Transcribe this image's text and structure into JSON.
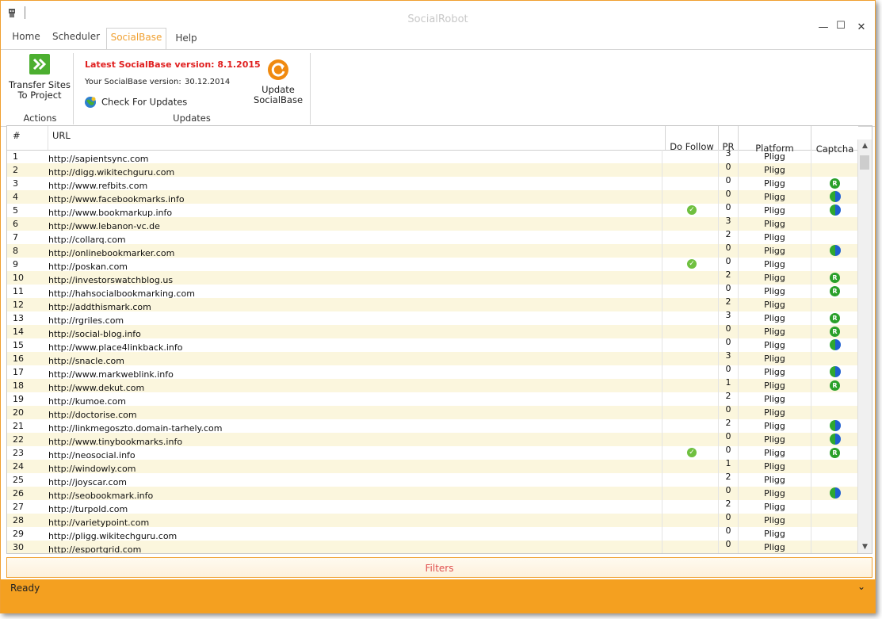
{
  "window": {
    "title": "SocialRobot",
    "minimize": "—",
    "maximize": "☐",
    "close": "✕"
  },
  "tabs": [
    "Home",
    "Scheduler",
    "SocialBase",
    "Help"
  ],
  "ribbon": {
    "actions": {
      "transfer_label_1": "Transfer Sites",
      "transfer_label_2": "To Project",
      "group_label": "Actions"
    },
    "updates": {
      "latest": "Latest SocialBase version: 8.1.2015",
      "yours_label": "Your SocialBase version:",
      "yours_value": "30.12.2014",
      "check": "Check For Updates",
      "update_label_1": "Update",
      "update_label_2": "SocialBase",
      "group_label": "Updates"
    }
  },
  "grid": {
    "headers": {
      "num": "#",
      "url": "URL",
      "dofollow": "Do Follow",
      "pr": "PR",
      "platform": "Platform",
      "captcha": "Captcha"
    },
    "rows": [
      {
        "n": "1",
        "url": "http://sapientsync.com",
        "df": false,
        "pr": "3",
        "plat": "Pligg",
        "cap": ""
      },
      {
        "n": "2",
        "url": "http://digg.wikitechguru.com",
        "df": false,
        "pr": "0",
        "plat": "Pligg",
        "cap": ""
      },
      {
        "n": "3",
        "url": "http://www.refbits.com",
        "df": false,
        "pr": "0",
        "plat": "Pligg",
        "cap": "R"
      },
      {
        "n": "4",
        "url": "http://www.facebookmarks.info",
        "df": false,
        "pr": "0",
        "plat": "Pligg",
        "cap": "B"
      },
      {
        "n": "5",
        "url": "http://www.bookmarkup.info",
        "df": true,
        "pr": "0",
        "plat": "Pligg",
        "cap": "B"
      },
      {
        "n": "6",
        "url": "http://www.lebanon-vc.de",
        "df": false,
        "pr": "3",
        "plat": "Pligg",
        "cap": ""
      },
      {
        "n": "7",
        "url": "http://collarq.com",
        "df": false,
        "pr": "2",
        "plat": "Pligg",
        "cap": ""
      },
      {
        "n": "8",
        "url": "http://onlinebookmarker.com",
        "df": false,
        "pr": "0",
        "plat": "Pligg",
        "cap": "B"
      },
      {
        "n": "9",
        "url": "http://poskan.com",
        "df": true,
        "pr": "0",
        "plat": "Pligg",
        "cap": ""
      },
      {
        "n": "10",
        "url": "http://investorswatchblog.us",
        "df": false,
        "pr": "2",
        "plat": "Pligg",
        "cap": "R"
      },
      {
        "n": "11",
        "url": "http://hahsocialbookmarking.com",
        "df": false,
        "pr": "0",
        "plat": "Pligg",
        "cap": "R"
      },
      {
        "n": "12",
        "url": "http://addthismark.com",
        "df": false,
        "pr": "2",
        "plat": "Pligg",
        "cap": ""
      },
      {
        "n": "13",
        "url": "http://rgriles.com",
        "df": false,
        "pr": "3",
        "plat": "Pligg",
        "cap": "R"
      },
      {
        "n": "14",
        "url": "http://social-blog.info",
        "df": false,
        "pr": "0",
        "plat": "Pligg",
        "cap": "R"
      },
      {
        "n": "15",
        "url": "http://www.place4linkback.info",
        "df": false,
        "pr": "0",
        "plat": "Pligg",
        "cap": "B"
      },
      {
        "n": "16",
        "url": "http://snacle.com",
        "df": false,
        "pr": "3",
        "plat": "Pligg",
        "cap": ""
      },
      {
        "n": "17",
        "url": "http://www.markweblink.info",
        "df": false,
        "pr": "0",
        "plat": "Pligg",
        "cap": "B"
      },
      {
        "n": "18",
        "url": "http://www.dekut.com",
        "df": false,
        "pr": "1",
        "plat": "Pligg",
        "cap": "R"
      },
      {
        "n": "19",
        "url": "http://kumoe.com",
        "df": false,
        "pr": "2",
        "plat": "Pligg",
        "cap": ""
      },
      {
        "n": "20",
        "url": "http://doctorise.com",
        "df": false,
        "pr": "0",
        "plat": "Pligg",
        "cap": ""
      },
      {
        "n": "21",
        "url": "http://linkmegoszto.domain-tarhely.com",
        "df": false,
        "pr": "2",
        "plat": "Pligg",
        "cap": "B"
      },
      {
        "n": "22",
        "url": "http://www.tinybookmarks.info",
        "df": false,
        "pr": "0",
        "plat": "Pligg",
        "cap": "B"
      },
      {
        "n": "23",
        "url": "http://neosocial.info",
        "df": true,
        "pr": "0",
        "plat": "Pligg",
        "cap": "R"
      },
      {
        "n": "24",
        "url": "http://windowly.com",
        "df": false,
        "pr": "1",
        "plat": "Pligg",
        "cap": ""
      },
      {
        "n": "25",
        "url": "http://joyscar.com",
        "df": false,
        "pr": "2",
        "plat": "Pligg",
        "cap": ""
      },
      {
        "n": "26",
        "url": "http://seobookmark.info",
        "df": false,
        "pr": "0",
        "plat": "Pligg",
        "cap": "B"
      },
      {
        "n": "27",
        "url": "http://turpold.com",
        "df": false,
        "pr": "2",
        "plat": "Pligg",
        "cap": ""
      },
      {
        "n": "28",
        "url": "http://varietypoint.com",
        "df": false,
        "pr": "0",
        "plat": "Pligg",
        "cap": ""
      },
      {
        "n": "29",
        "url": "http://pligg.wikitechguru.com",
        "df": false,
        "pr": "0",
        "plat": "Pligg",
        "cap": ""
      },
      {
        "n": "30",
        "url": "http://esportgrid.com",
        "df": false,
        "pr": "0",
        "plat": "Pligg",
        "cap": ""
      }
    ]
  },
  "filters_label": "Filters",
  "status": {
    "text": "Ready",
    "expand": "⌄"
  },
  "colors": {
    "accent": "#f4a020",
    "alt_row": "#fbf6dd",
    "latest_version": "#e02020",
    "filters_text": "#e05050"
  }
}
